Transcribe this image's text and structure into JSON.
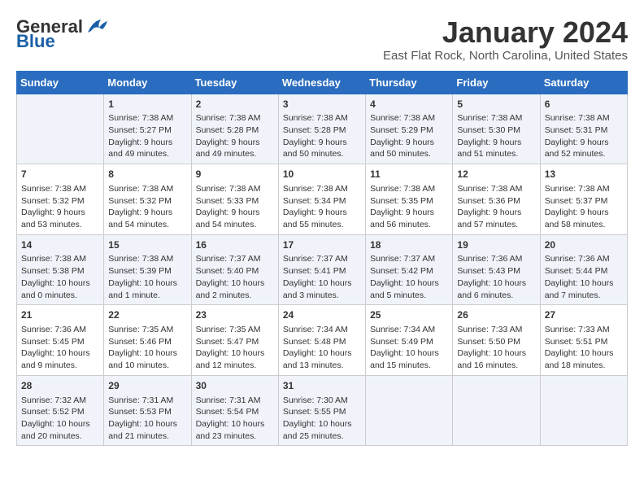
{
  "logo": {
    "text_general": "General",
    "text_blue": "Blue"
  },
  "title": "January 2024",
  "subtitle": "East Flat Rock, North Carolina, United States",
  "days_header": [
    "Sunday",
    "Monday",
    "Tuesday",
    "Wednesday",
    "Thursday",
    "Friday",
    "Saturday"
  ],
  "weeks": [
    [
      {
        "day": "",
        "info": ""
      },
      {
        "day": "1",
        "info": "Sunrise: 7:38 AM\nSunset: 5:27 PM\nDaylight: 9 hours\nand 49 minutes."
      },
      {
        "day": "2",
        "info": "Sunrise: 7:38 AM\nSunset: 5:28 PM\nDaylight: 9 hours\nand 49 minutes."
      },
      {
        "day": "3",
        "info": "Sunrise: 7:38 AM\nSunset: 5:28 PM\nDaylight: 9 hours\nand 50 minutes."
      },
      {
        "day": "4",
        "info": "Sunrise: 7:38 AM\nSunset: 5:29 PM\nDaylight: 9 hours\nand 50 minutes."
      },
      {
        "day": "5",
        "info": "Sunrise: 7:38 AM\nSunset: 5:30 PM\nDaylight: 9 hours\nand 51 minutes."
      },
      {
        "day": "6",
        "info": "Sunrise: 7:38 AM\nSunset: 5:31 PM\nDaylight: 9 hours\nand 52 minutes."
      }
    ],
    [
      {
        "day": "7",
        "info": "Sunrise: 7:38 AM\nSunset: 5:32 PM\nDaylight: 9 hours\nand 53 minutes."
      },
      {
        "day": "8",
        "info": "Sunrise: 7:38 AM\nSunset: 5:32 PM\nDaylight: 9 hours\nand 54 minutes."
      },
      {
        "day": "9",
        "info": "Sunrise: 7:38 AM\nSunset: 5:33 PM\nDaylight: 9 hours\nand 54 minutes."
      },
      {
        "day": "10",
        "info": "Sunrise: 7:38 AM\nSunset: 5:34 PM\nDaylight: 9 hours\nand 55 minutes."
      },
      {
        "day": "11",
        "info": "Sunrise: 7:38 AM\nSunset: 5:35 PM\nDaylight: 9 hours\nand 56 minutes."
      },
      {
        "day": "12",
        "info": "Sunrise: 7:38 AM\nSunset: 5:36 PM\nDaylight: 9 hours\nand 57 minutes."
      },
      {
        "day": "13",
        "info": "Sunrise: 7:38 AM\nSunset: 5:37 PM\nDaylight: 9 hours\nand 58 minutes."
      }
    ],
    [
      {
        "day": "14",
        "info": "Sunrise: 7:38 AM\nSunset: 5:38 PM\nDaylight: 10 hours\nand 0 minutes."
      },
      {
        "day": "15",
        "info": "Sunrise: 7:38 AM\nSunset: 5:39 PM\nDaylight: 10 hours\nand 1 minute."
      },
      {
        "day": "16",
        "info": "Sunrise: 7:37 AM\nSunset: 5:40 PM\nDaylight: 10 hours\nand 2 minutes."
      },
      {
        "day": "17",
        "info": "Sunrise: 7:37 AM\nSunset: 5:41 PM\nDaylight: 10 hours\nand 3 minutes."
      },
      {
        "day": "18",
        "info": "Sunrise: 7:37 AM\nSunset: 5:42 PM\nDaylight: 10 hours\nand 5 minutes."
      },
      {
        "day": "19",
        "info": "Sunrise: 7:36 AM\nSunset: 5:43 PM\nDaylight: 10 hours\nand 6 minutes."
      },
      {
        "day": "20",
        "info": "Sunrise: 7:36 AM\nSunset: 5:44 PM\nDaylight: 10 hours\nand 7 minutes."
      }
    ],
    [
      {
        "day": "21",
        "info": "Sunrise: 7:36 AM\nSunset: 5:45 PM\nDaylight: 10 hours\nand 9 minutes."
      },
      {
        "day": "22",
        "info": "Sunrise: 7:35 AM\nSunset: 5:46 PM\nDaylight: 10 hours\nand 10 minutes."
      },
      {
        "day": "23",
        "info": "Sunrise: 7:35 AM\nSunset: 5:47 PM\nDaylight: 10 hours\nand 12 minutes."
      },
      {
        "day": "24",
        "info": "Sunrise: 7:34 AM\nSunset: 5:48 PM\nDaylight: 10 hours\nand 13 minutes."
      },
      {
        "day": "25",
        "info": "Sunrise: 7:34 AM\nSunset: 5:49 PM\nDaylight: 10 hours\nand 15 minutes."
      },
      {
        "day": "26",
        "info": "Sunrise: 7:33 AM\nSunset: 5:50 PM\nDaylight: 10 hours\nand 16 minutes."
      },
      {
        "day": "27",
        "info": "Sunrise: 7:33 AM\nSunset: 5:51 PM\nDaylight: 10 hours\nand 18 minutes."
      }
    ],
    [
      {
        "day": "28",
        "info": "Sunrise: 7:32 AM\nSunset: 5:52 PM\nDaylight: 10 hours\nand 20 minutes."
      },
      {
        "day": "29",
        "info": "Sunrise: 7:31 AM\nSunset: 5:53 PM\nDaylight: 10 hours\nand 21 minutes."
      },
      {
        "day": "30",
        "info": "Sunrise: 7:31 AM\nSunset: 5:54 PM\nDaylight: 10 hours\nand 23 minutes."
      },
      {
        "day": "31",
        "info": "Sunrise: 7:30 AM\nSunset: 5:55 PM\nDaylight: 10 hours\nand 25 minutes."
      },
      {
        "day": "",
        "info": ""
      },
      {
        "day": "",
        "info": ""
      },
      {
        "day": "",
        "info": ""
      }
    ]
  ]
}
